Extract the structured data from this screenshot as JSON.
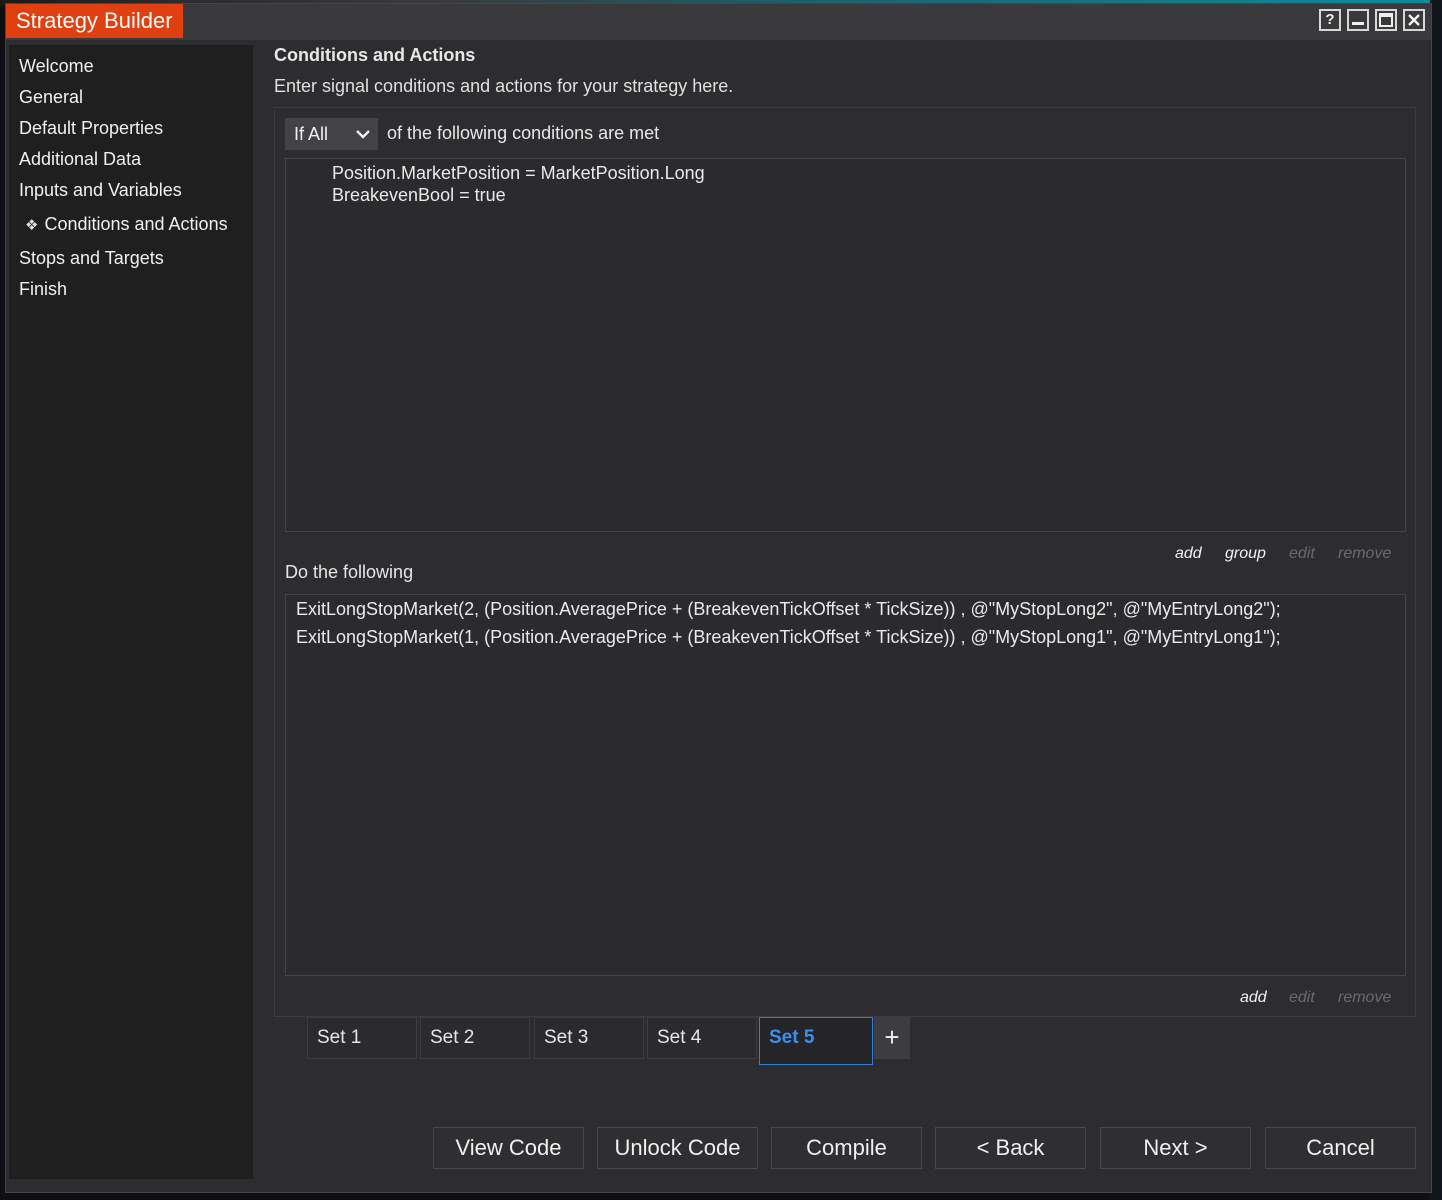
{
  "window": {
    "title": "Strategy Builder",
    "controls": {
      "help": "?",
      "minimize": "—",
      "maximize": "☐",
      "close": "✕"
    }
  },
  "sidebar": {
    "items": [
      {
        "label": "Welcome"
      },
      {
        "label": "General"
      },
      {
        "label": "Default Properties"
      },
      {
        "label": "Additional Data"
      },
      {
        "label": "Inputs and Variables"
      },
      {
        "label": "Conditions and Actions",
        "active": true
      },
      {
        "label": "Stops and Targets"
      },
      {
        "label": "Finish"
      }
    ]
  },
  "main": {
    "title": "Conditions and Actions",
    "subtitle": "Enter signal conditions and actions for your strategy here."
  },
  "conditions": {
    "mode": "If All",
    "mode_tail": "of the following conditions are met",
    "lines": [
      "Position.MarketPosition = MarketPosition.Long",
      "BreakevenBool = true"
    ],
    "links": {
      "add": "add",
      "group": "group",
      "edit": "edit",
      "remove": "remove"
    }
  },
  "actions": {
    "label": "Do the following",
    "lines": [
      "ExitLongStopMarket(2, (Position.AveragePrice + (BreakevenTickOffset * TickSize)) , @\"MyStopLong2\", @\"MyEntryLong2\");",
      "ExitLongStopMarket(1, (Position.AveragePrice + (BreakevenTickOffset * TickSize)) , @\"MyStopLong1\", @\"MyEntryLong1\");"
    ],
    "links": {
      "add": "add",
      "edit": "edit",
      "remove": "remove"
    }
  },
  "sets": {
    "tabs": [
      "Set 1",
      "Set 2",
      "Set 3",
      "Set 4",
      "Set 5"
    ],
    "active_index": 4,
    "add_label": "+"
  },
  "footer": {
    "view_code": "View Code",
    "unlock_code": "Unlock Code",
    "compile": "Compile",
    "back": "< Back",
    "next": "Next >",
    "cancel": "Cancel"
  },
  "colors": {
    "title_accent": "#e0400f",
    "active_tab": "#3c8ef0",
    "panel_bg": "#2d2d30",
    "sidebar_bg": "#1f1f20"
  }
}
